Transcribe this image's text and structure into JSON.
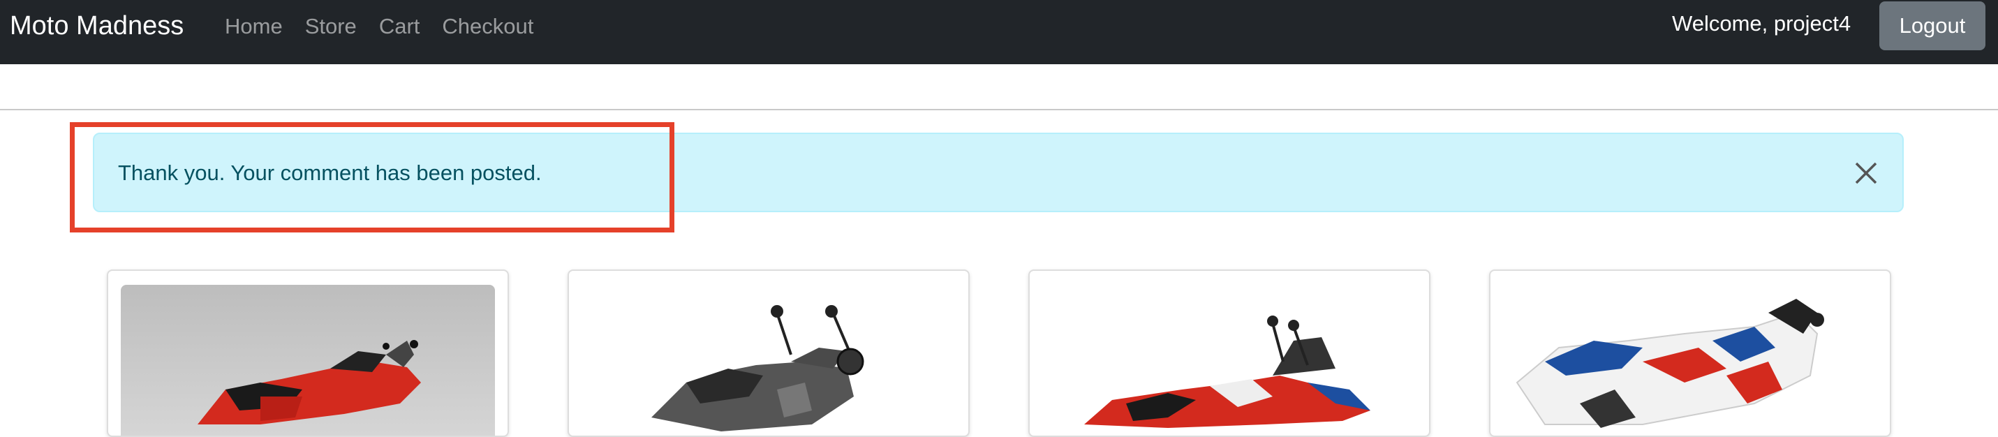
{
  "navbar": {
    "brand": "Moto Madness",
    "links": [
      "Home",
      "Store",
      "Cart",
      "Checkout"
    ],
    "welcome": "Welcome, project4",
    "logout_label": "Logout"
  },
  "alert": {
    "message": "Thank you. Your comment has been posted."
  },
  "products": [
    {
      "image": "red sport motorcycle"
    },
    {
      "image": "grey naked motorcycle"
    },
    {
      "image": "red dual-sport motorcycle"
    },
    {
      "image": "white blue red sport motorcycle"
    }
  ],
  "colors": {
    "navbar_bg": "#212529",
    "alert_bg": "#cff4fc",
    "alert_text": "#055160",
    "highlight": "#e5412a",
    "logout_bg": "#6c757d"
  }
}
